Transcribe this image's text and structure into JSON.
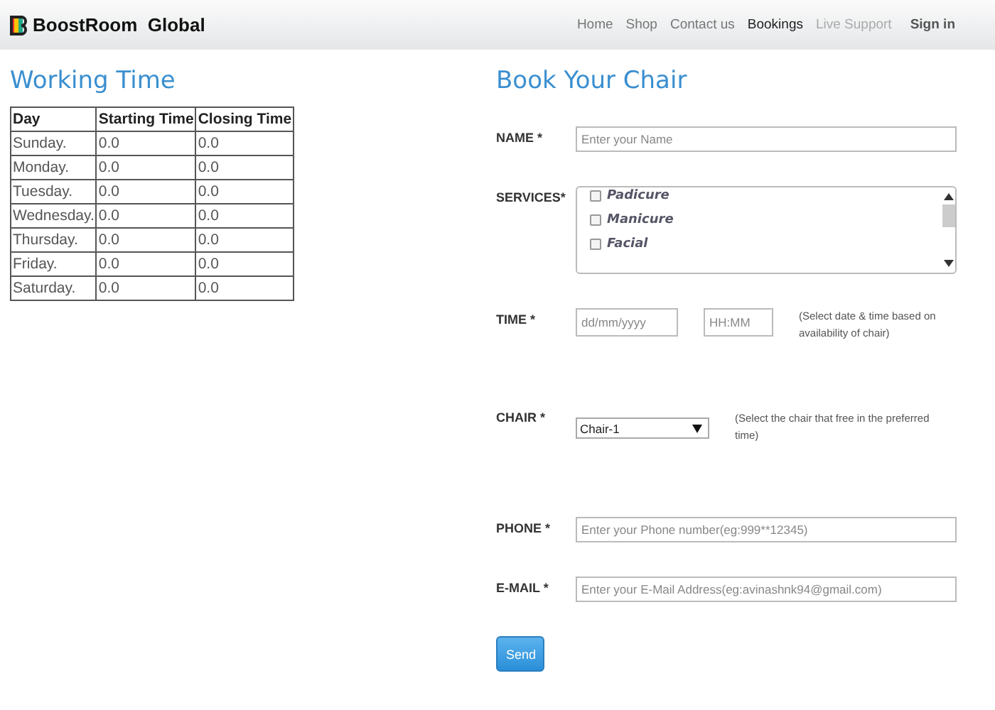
{
  "navbar": {
    "brand": "BoostRoom  Global",
    "links": [
      {
        "label": "Home",
        "kind": "link",
        "selected": false,
        "muted": false
      },
      {
        "label": "Shop",
        "kind": "link",
        "selected": false,
        "muted": false
      },
      {
        "label": "Contact us",
        "kind": "link",
        "selected": false,
        "muted": false
      },
      {
        "label": "Bookings",
        "kind": "link",
        "selected": true,
        "muted": false
      },
      {
        "label": "Live Support",
        "kind": "link",
        "selected": false,
        "muted": true
      },
      {
        "label": "Sign in",
        "kind": "signin",
        "selected": false,
        "muted": false
      }
    ]
  },
  "working_time": {
    "title": "Working Time",
    "table": {
      "columns": [
        "Day",
        "Starting Time",
        "Closing Time"
      ],
      "rows": [
        [
          "Sunday.",
          "0.0",
          "0.0"
        ],
        [
          "Monday.",
          "0.0",
          "0.0"
        ],
        [
          "Tuesday.",
          "0.0",
          "0.0"
        ],
        [
          "Wednesday.",
          "0.0",
          "0.0"
        ],
        [
          "Thursday.",
          "0.0",
          "0.0"
        ],
        [
          "Friday.",
          "0.0",
          "0.0"
        ],
        [
          "Saturday.",
          "0.0",
          "0.0"
        ]
      ]
    }
  },
  "booking": {
    "title": "Book Your Chair",
    "fields": [
      {
        "kind": "text",
        "label": "NAME *",
        "placeholder": "Enter your Name"
      },
      {
        "kind": "services",
        "label": "SERVICES*",
        "options": [
          {
            "label": "Padicure",
            "checked": false
          },
          {
            "label": "Manicure",
            "checked": false
          },
          {
            "label": "Facial",
            "checked": false
          }
        ]
      },
      {
        "kind": "datetime",
        "label": "TIME *",
        "date_placeholder": "dd/mm/yyyy",
        "time_placeholder": "HH:MM",
        "hint": "(Select date & time based on availability of chair)"
      },
      {
        "kind": "select",
        "label": "CHAIR *",
        "value": "Chair-1",
        "hint": "(Select the chair that free in the preferred time)"
      },
      {
        "kind": "text",
        "label": "PHONE *",
        "placeholder": "Enter your Phone number(eg:999**12345)"
      },
      {
        "kind": "text",
        "label": "E-MAIL *",
        "placeholder": "Enter your E-Mail Address(eg:avinashnk94@gmail.com)"
      }
    ],
    "submit": "Send"
  }
}
